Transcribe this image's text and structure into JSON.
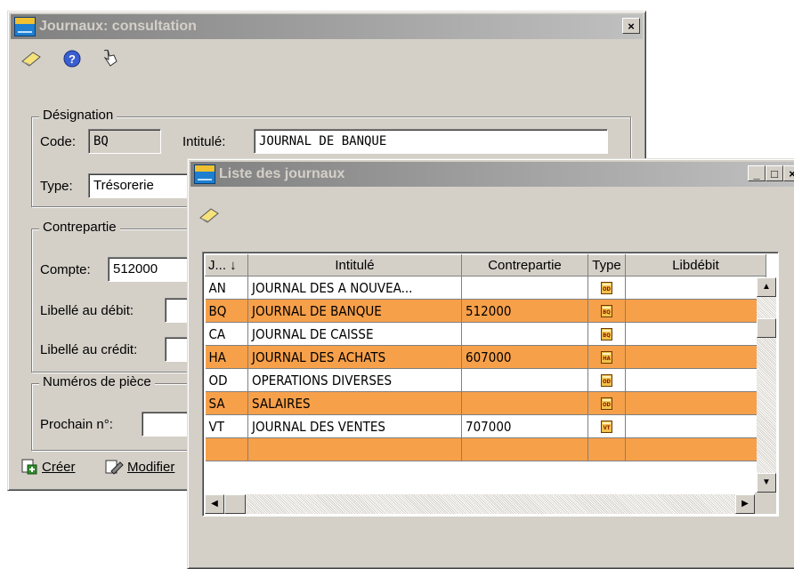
{
  "consultation": {
    "title": "Journaux: consultation",
    "close_label": "×",
    "toolbar": [
      "edit-icon",
      "help-icon",
      "pointer-icon"
    ],
    "designation": {
      "legend": "Désignation",
      "code_label": "Code:",
      "code_value": "BQ",
      "intitule_label": "Intitulé:",
      "intitule_value": "JOURNAL DE BANQUE",
      "type_label": "Type:",
      "type_value": "Trésorerie"
    },
    "contrepartie": {
      "legend": "Contrepartie",
      "compte_label": "Compte:",
      "compte_value": "512000",
      "libelle_debit_label": "Libellé au débit:",
      "libelle_credit_label": "Libellé au crédit:"
    },
    "numeros": {
      "legend": "Numéros de pièce",
      "prochain_label": "Prochain n°:"
    },
    "buttons": {
      "creer": "Créer",
      "modifier": "Modifier"
    }
  },
  "liste": {
    "title": "Liste des journaux",
    "window_buttons": [
      "_",
      "□",
      "×"
    ],
    "columns": [
      "J... ↓",
      "Intitulé",
      "Contrepartie",
      "Type",
      "Libdébit"
    ],
    "rows": [
      {
        "code": "AN",
        "intitule": "JOURNAL DES A NOUVEA...",
        "contrepartie": "",
        "type": "OD",
        "highlight": false
      },
      {
        "code": "BQ",
        "intitule": "JOURNAL DE BANQUE",
        "contrepartie": "512000",
        "type": "BQ",
        "highlight": true
      },
      {
        "code": "CA",
        "intitule": "JOURNAL DE CAISSE",
        "contrepartie": "",
        "type": "BQ",
        "highlight": false
      },
      {
        "code": "HA",
        "intitule": "JOURNAL DES ACHATS",
        "contrepartie": "607000",
        "type": "HA",
        "highlight": true
      },
      {
        "code": "OD",
        "intitule": "OPERATIONS DIVERSES",
        "contrepartie": "",
        "type": "OD",
        "highlight": false
      },
      {
        "code": "SA",
        "intitule": "SALAIRES",
        "contrepartie": "",
        "type": "OD",
        "highlight": true
      },
      {
        "code": "VT",
        "intitule": "JOURNAL DES VENTES",
        "contrepartie": "707000",
        "type": "VT",
        "highlight": false
      },
      {
        "code": "",
        "intitule": "",
        "contrepartie": "",
        "type": "",
        "highlight": true
      }
    ]
  },
  "colors": {
    "window_bg": "#d4d0c8",
    "inactive_title": "#808080",
    "row_highlight": "#f7a04a",
    "type_icon": "#f2c24a"
  }
}
